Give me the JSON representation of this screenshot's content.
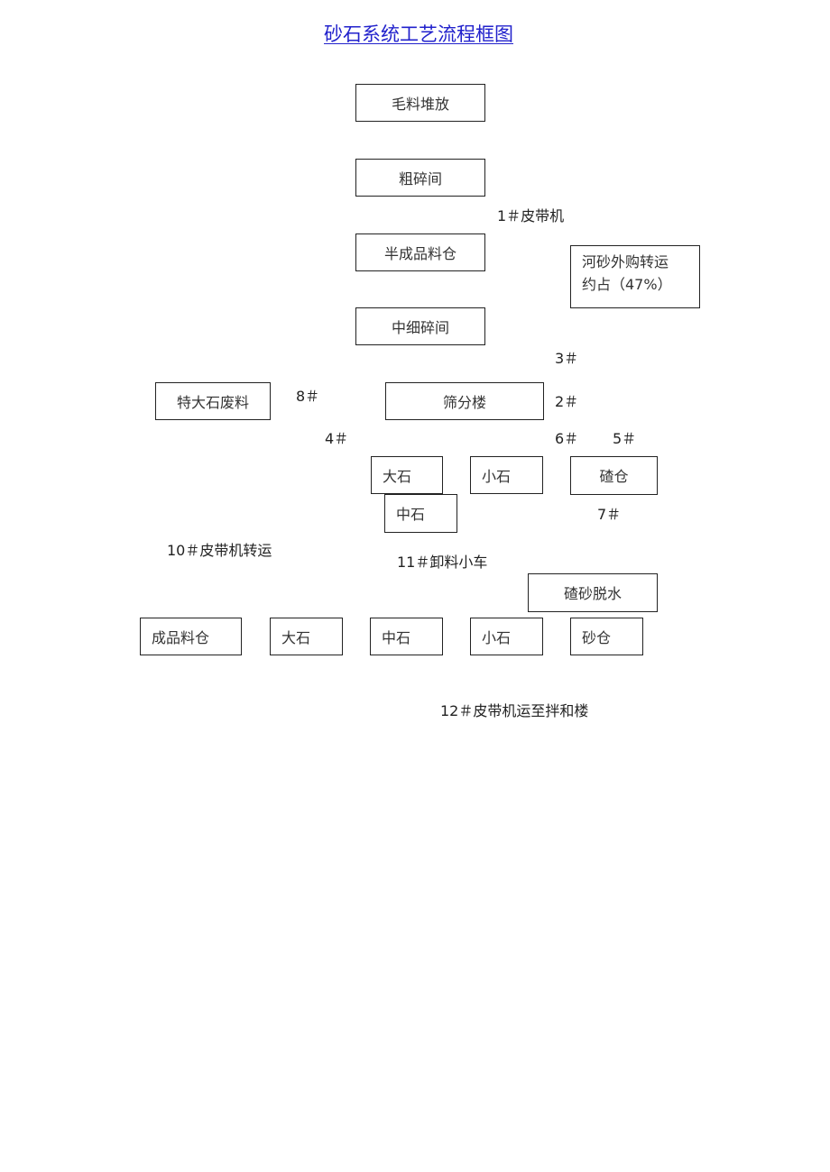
{
  "title": "砂石系统工艺流程框图",
  "boxes": {
    "raw_stockpile": "毛料堆放",
    "coarse_crushing": "粗碎间",
    "semi_product_bin": "半成品料仓",
    "river_sand": "河砂外购转运\n约占（47%）",
    "medium_fine_crushing": "中细碎间",
    "oversize_waste": "特大石废料",
    "screening_building": "筛分楼",
    "large_stone_1": "大石",
    "small_stone_1": "小石",
    "sand_bin_1": "碴仓",
    "medium_stone_1": "中石",
    "sand_dewatering": "碴砂脱水",
    "finished_bin": "成品料仓",
    "large_stone_2": "大石",
    "medium_stone_2": "中石",
    "small_stone_2": "小石",
    "sand_bin_2": "砂仓"
  },
  "labels": {
    "belt_1": "1＃皮带机",
    "belt_3": "3＃",
    "belt_8": "8＃",
    "belt_2": "2＃",
    "belt_4": "4＃",
    "belt_6": "6＃",
    "belt_5": "5＃",
    "belt_7": "7＃",
    "belt_10": "10＃皮带机转运",
    "belt_11": "11＃卸料小车",
    "belt_12": "12＃皮带机运至拌和楼"
  }
}
